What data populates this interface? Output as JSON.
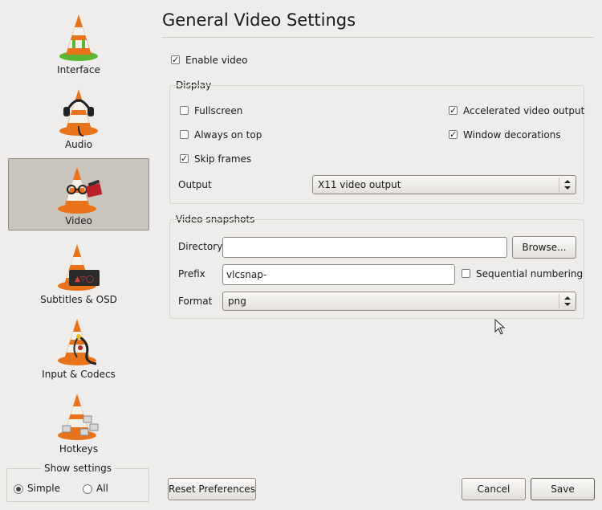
{
  "sidebar": {
    "items": [
      {
        "label": "Interface",
        "icon": "cone-interface-icon"
      },
      {
        "label": "Audio",
        "icon": "cone-headphones-icon"
      },
      {
        "label": "Video",
        "icon": "cone-glasses-film-icon"
      },
      {
        "label": "Subtitles & OSD",
        "icon": "cone-subtitles-icon"
      },
      {
        "label": "Input & Codecs",
        "icon": "cone-cable-icon"
      },
      {
        "label": "Hotkeys",
        "icon": "cone-keyboard-icon"
      }
    ],
    "selected": "Video"
  },
  "show_settings": {
    "title": "Show settings",
    "simple_label": "Simple",
    "all_label": "All",
    "selected": "Simple"
  },
  "page": {
    "title": "General Video Settings",
    "enable_video": {
      "label": "Enable video",
      "checked": true
    }
  },
  "display": {
    "title": "Display",
    "fullscreen": {
      "label": "Fullscreen",
      "checked": false
    },
    "always_on_top": {
      "label": "Always on top",
      "checked": false
    },
    "skip_frames": {
      "label": "Skip frames",
      "checked": true
    },
    "accelerated": {
      "label": "Accelerated video output",
      "checked": true
    },
    "window_decorations": {
      "label": "Window decorations",
      "checked": true
    },
    "output_label": "Output",
    "output_value": "X11 video output"
  },
  "snapshots": {
    "title": "Video snapshots",
    "directory_label": "Directory",
    "directory_value": "",
    "browse_label": "Browse...",
    "prefix_label": "Prefix",
    "prefix_value": "vlcsnap-",
    "sequential_label": "Sequential numbering",
    "sequential_checked": false,
    "format_label": "Format",
    "format_value": "png"
  },
  "buttons": {
    "reset_label": "Reset Preferences",
    "cancel_label": "Cancel",
    "save_label": "Save"
  },
  "colors": {
    "cone_orange": "#e8731a",
    "cone_white": "#f4f1ea",
    "cone_green": "#5bb634",
    "selection_bg": "#c9c5bd"
  }
}
